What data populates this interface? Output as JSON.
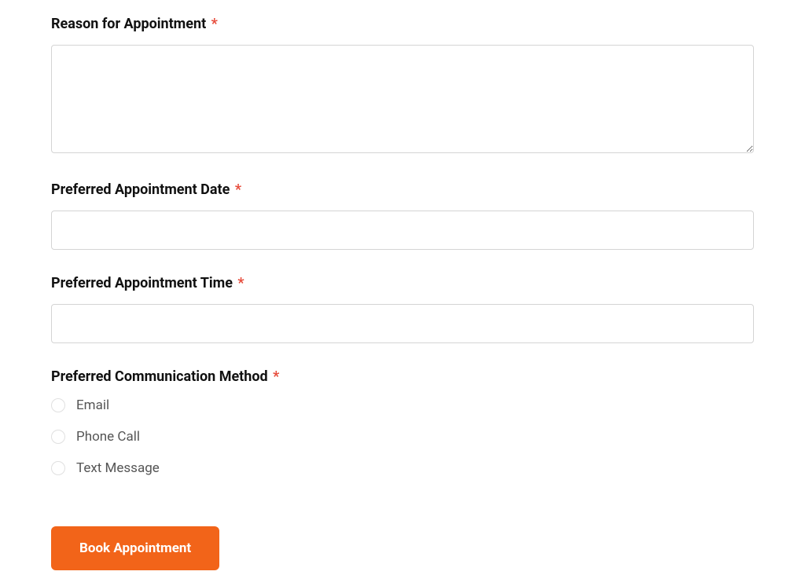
{
  "form": {
    "reason": {
      "label": "Reason for Appointment",
      "value": ""
    },
    "date": {
      "label": "Preferred Appointment Date",
      "value": ""
    },
    "time": {
      "label": "Preferred Appointment Time",
      "value": ""
    },
    "communication": {
      "label": "Preferred Communication Method",
      "options": [
        {
          "label": "Email"
        },
        {
          "label": "Phone Call"
        },
        {
          "label": "Text Message"
        }
      ]
    },
    "required_marker": "*",
    "submit_label": "Book Appointment"
  }
}
